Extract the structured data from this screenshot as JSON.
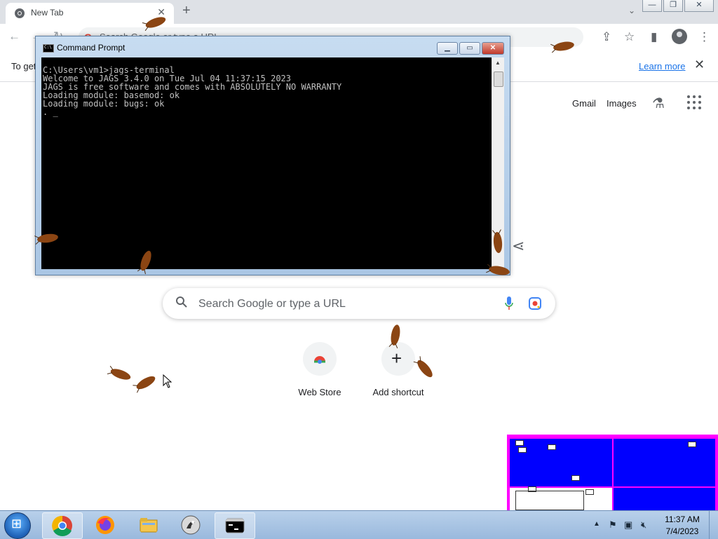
{
  "browser": {
    "tab_title": "New Tab",
    "new_tab_glyph": "+",
    "tab_close_glyph": "✕",
    "tab_search_glyph": "⌄",
    "window_controls": [
      "—",
      "❐",
      "✕"
    ],
    "omnibox_text": "Search Google or type a URL",
    "infobar_text": "To get",
    "infobar_link": "Learn more"
  },
  "ntp": {
    "links": [
      "Gmail",
      "Images"
    ],
    "search_placeholder": "Search Google or type a URL",
    "shortcuts": [
      {
        "label": "Web Store",
        "icon": "chrome-web-store-icon"
      },
      {
        "label": "Add shortcut",
        "icon": "plus-icon"
      }
    ]
  },
  "cmd": {
    "title": "Command Prompt",
    "lines": [
      "C:\\Users\\vm1>jags-terminal",
      "Welcome to JAGS 3.4.0 on Tue Jul 04 11:37:15 2023",
      "JAGS is free software and comes with ABSOLUTELY NO WARRANTY",
      "Loading module: basemod: ok",
      "Loading module: bugs: ok",
      ". _"
    ],
    "controls": [
      "▁",
      "▭",
      "✕"
    ]
  },
  "taskbar": {
    "items": [
      "chrome-icon",
      "firefox-icon",
      "file-explorer-icon",
      "gimp-icon",
      "command-prompt-icon"
    ],
    "clock_time": "11:37 AM",
    "clock_date": "7/4/2023"
  },
  "colors": {
    "chrome_tabstrip": "#dee1e6",
    "link_blue": "#1a73e8",
    "grid_blue": "#0000ff",
    "grid_border": "#ff00ff",
    "roach": "#8b4513"
  }
}
